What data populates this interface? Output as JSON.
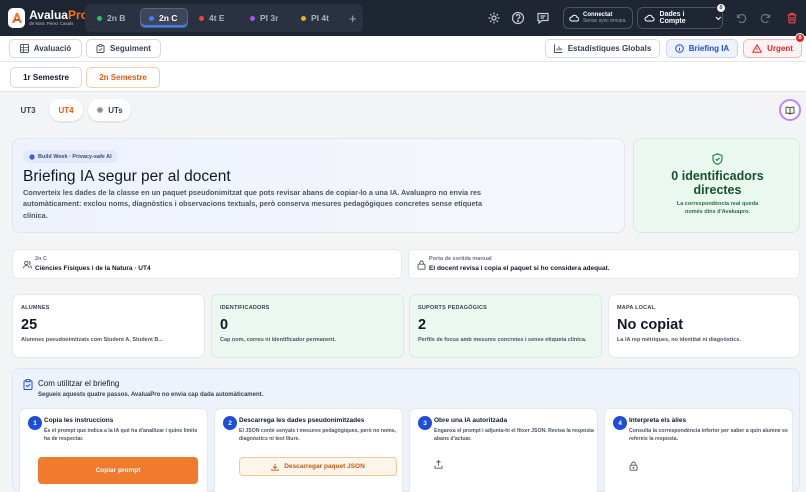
{
  "app": {
    "name_a": "Avalua",
    "name_b": "Pro",
    "author": "de Marc Pérez Casals"
  },
  "groups": [
    {
      "label": "2n B",
      "color": "#22c55e"
    },
    {
      "label": "2n C",
      "color": "#3b82f6"
    },
    {
      "label": "4t E",
      "color": "#ef4444"
    },
    {
      "label": "PI 3r",
      "color": "#a855f7"
    },
    {
      "label": "PI 4t",
      "color": "#eab308"
    }
  ],
  "connection": {
    "status": "Connectat",
    "detail": "Sense sync encara"
  },
  "account": {
    "label": "Dades i Compte",
    "badge": "0"
  },
  "nav": {
    "avaluacio": "Avaluació",
    "seguiment": "Seguiment",
    "estadistiques": "Estadístiques Globals",
    "briefing": "Briefing IA",
    "urgent": "Urgent",
    "urgent_badge": "8"
  },
  "semesters": {
    "first": "1r Semestre",
    "second": "2n Semestre"
  },
  "units": {
    "ut3": "UT3",
    "ut4": "UT4",
    "uts": "UTs"
  },
  "hero": {
    "badge": "Build Week · Privacy-safe AI",
    "title": "Briefing IA segur per al docent",
    "description": "Converteix les dades de la classe en un paquet pseudonimitzat que pots revisar abans de copiar-lo a una IA. Avaluapro no envia res automàticament: exclou noms, diagnòstics i observacions textuals, però conserva mesures pedagògiques concretes sense etiqueta clínica."
  },
  "identifiers": {
    "title_line1": "0 identificadors",
    "title_line2": "directes",
    "note_line1": "La correspondència real queda",
    "note_line2": "només dins d'Avaluapro."
  },
  "context": {
    "group": "2n C",
    "subject": "Ciències Físiques i de la Natura · UT4",
    "gate_label": "Porta de sortida manual",
    "gate_text": "El docent revisa i copia el paquet si ho considera adequat."
  },
  "stats": [
    {
      "label": "ALUMNES",
      "value": "25",
      "desc": "Alumnes pseudonimitzats com Student A, Student B...",
      "bg": "#ffffff"
    },
    {
      "label": "IDENTIFICADORS",
      "value": "0",
      "desc": "Cap nom, correu ni identificador permanent.",
      "bg": "#eaf8ef"
    },
    {
      "label": "SUPORTS PEDAGÒGICS",
      "value": "2",
      "desc": "Perfils de focus amb mesures concretes i sense etiqueta clínica.",
      "bg": "#eaf8ef"
    },
    {
      "label": "MAPA LOCAL",
      "value": "No copiat",
      "desc": "La IA rep mètriques, no identitat ni diagnòstics.",
      "bg": "#ffffff"
    }
  ],
  "howto": {
    "title": "Com utilitzar el briefing",
    "subtitle": "Segueix aquests quatre passos. AvaluaPro no envia cap dada automàticament.",
    "steps": [
      {
        "n": "1",
        "title": "Copia les instruccions",
        "desc": "És el prompt que indica a la IA què ha d'analitzar i quins límits ha de respectar."
      },
      {
        "n": "2",
        "title": "Descarrega les dades pseudonimitzades",
        "desc": "El JSON conté senyals i mesures pedagògiques, però no noms, diagnòstics ni text lliure."
      },
      {
        "n": "3",
        "title": "Obre una IA autoritzada",
        "desc": "Enganxa el prompt i adjunta-hi el fitxer JSON. Revisa la resposta abans d'actuar."
      },
      {
        "n": "4",
        "title": "Interpreta els àlies",
        "desc": "Consulta la correspondència inferior per saber a quin alumne es refereix la resposta."
      }
    ],
    "copy_button": "Copiar prompt",
    "download_button": "Descarregar paquet JSON"
  },
  "colors": {
    "accent": "#f97316",
    "primary": "#1d4ed8",
    "topbar": "#1e2533",
    "success_bg": "#eaf8ef",
    "urgent": "#dc2626"
  }
}
